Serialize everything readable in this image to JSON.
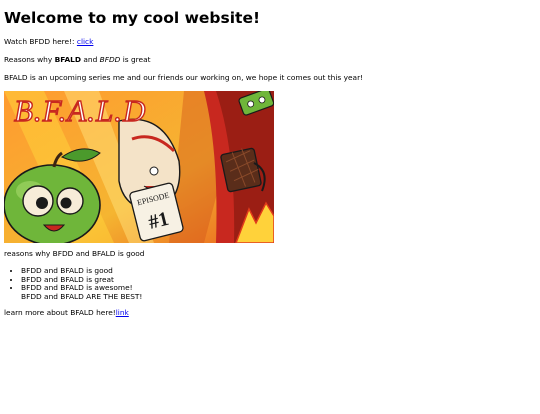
{
  "heading": "Welcome to my cool website!",
  "watch": {
    "text": "Watch BFDD here!:",
    "link": "click"
  },
  "reasons_line": {
    "prefix": "Reasons why",
    "bold": "BFALD",
    "middle": "and",
    "italic": "BFDD",
    "suffix": "is great"
  },
  "intro": "BFALD is an upcoming series me and our friends our working on, we hope it comes out this year!",
  "hero": {
    "logo_text": "B.F.A.L.D",
    "badge_text": "EPISODE",
    "badge_number": "#1",
    "colors": {
      "orange": "#f28a22",
      "red": "#c8281f",
      "green": "#6fb63a",
      "cream": "#f4e3c8",
      "yellow": "#ffd23a"
    }
  },
  "list_intro": "reasons why BFDD and BFALD is good",
  "list": [
    "BFDD and BFALD is good",
    "BFDD and BFALD is great",
    "BFDD and BFALD is awesome!"
  ],
  "list_tail": "BFDD and BFALD ARE THE BEST!",
  "learn": {
    "text": "learn more about BFALD here!",
    "link": "link"
  }
}
